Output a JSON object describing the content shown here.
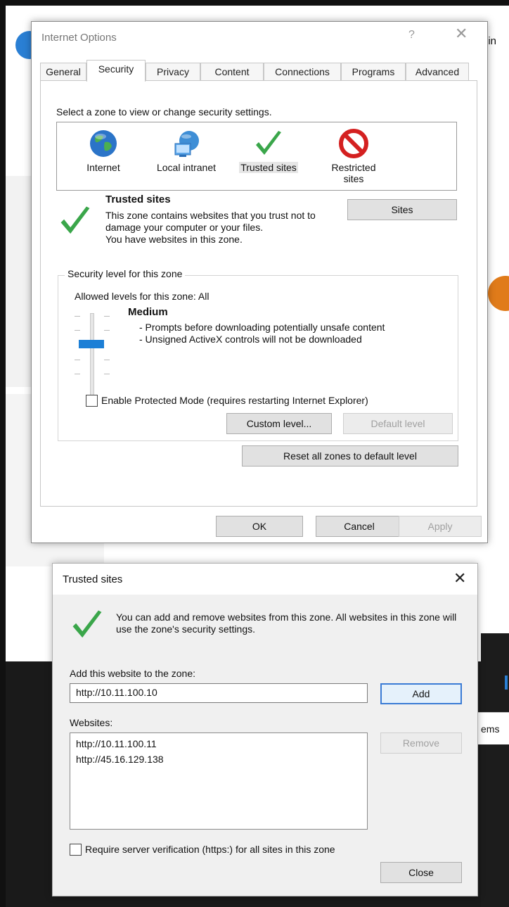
{
  "background": {
    "login_fragment": "gin",
    "items_fragment": "ems"
  },
  "internet_options": {
    "title": "Internet Options",
    "help_glyph": "?",
    "close_glyph": "✕",
    "tabs": [
      "General",
      "Security",
      "Privacy",
      "Content",
      "Connections",
      "Programs",
      "Advanced"
    ],
    "active_tab": "Security",
    "zone_prompt": "Select a zone to view or change security settings.",
    "zones": [
      {
        "label": "Internet",
        "icon": "globe-icon"
      },
      {
        "label": "Local intranet",
        "icon": "intranet-icon"
      },
      {
        "label": "Trusted sites",
        "icon": "checkmark-icon",
        "selected": true
      },
      {
        "label": "Restricted sites",
        "icon": "blocked-icon"
      }
    ],
    "selected_zone_title": "Trusted sites",
    "selected_zone_desc": "This zone contains websites that you trust not to damage your computer or your files.",
    "selected_zone_note": "You have websites in this zone.",
    "sites_button": "Sites",
    "security_level_legend": "Security level for this zone",
    "allowed_levels": "Allowed levels for this zone: All",
    "level_name": "Medium",
    "level_bullets": [
      "- Prompts before downloading potentially unsafe content",
      "- Unsigned ActiveX controls will not be downloaded"
    ],
    "protected_mode_label": "Enable Protected Mode (requires restarting Internet Explorer)",
    "protected_mode_checked": false,
    "custom_level_button": "Custom level...",
    "default_level_button": "Default level",
    "reset_all_button": "Reset all zones to default level",
    "ok_button": "OK",
    "cancel_button": "Cancel",
    "apply_button": "Apply"
  },
  "trusted_sites": {
    "title": "Trusted sites",
    "close_glyph": "✕",
    "description": "You can add and remove websites from this zone. All websites in this zone will use the zone's security settings.",
    "add_label": "Add this website to the zone:",
    "add_value": "http://10.11.100.10",
    "add_button": "Add",
    "websites_label": "Websites:",
    "websites": [
      "http://10.11.100.11",
      "http://45.16.129.138"
    ],
    "remove_button": "Remove",
    "require_https_label": "Require server verification (https:) for all sites in this zone",
    "require_https_checked": false,
    "close_button": "Close"
  }
}
